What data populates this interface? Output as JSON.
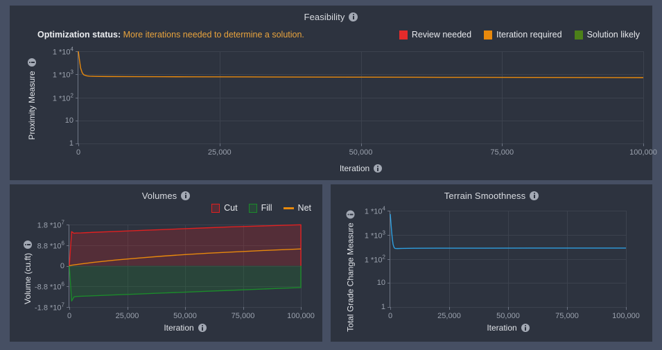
{
  "theme": {
    "page_background": "#464f63",
    "panel_background": "#2d333f",
    "grid_color": "#3c424e",
    "axis_text_color": "#9ba2ae",
    "title_color": "#d8dbe0"
  },
  "feasibility": {
    "title": "Feasibility",
    "info_icon": "info-icon",
    "status": {
      "label": "Optimization status:",
      "value": "More iterations needed to determine a solution.",
      "value_color": "#e8a33d"
    },
    "legend": [
      {
        "label": "Review needed",
        "color": "#e42b2b",
        "style": "box"
      },
      {
        "label": "Iteration required",
        "color": "#e8890c",
        "style": "box"
      },
      {
        "label": "Solution likely",
        "color": "#4c8019",
        "style": "box"
      }
    ]
  },
  "volumes": {
    "title": "Volumes",
    "info_icon": "info-icon",
    "legend": [
      {
        "label": "Cut",
        "color": "#e02020",
        "style": "hollow-box"
      },
      {
        "label": "Fill",
        "color": "#1c8a2b",
        "style": "hollow-box"
      },
      {
        "label": "Net",
        "color": "#e8890c",
        "style": "line"
      }
    ]
  },
  "terrain": {
    "title": "Terrain Smoothness",
    "info_icon": "info-icon"
  },
  "chart_data": [
    {
      "id": "feasibility",
      "type": "line",
      "title": "Feasibility",
      "xlabel": "Iteration",
      "ylabel": "Proximity Measure",
      "yscale": "log",
      "ylim": [
        1,
        10000
      ],
      "yticks": [
        1,
        10,
        100,
        1000,
        10000
      ],
      "ytick_labels": [
        "1",
        "10",
        "1 *10²",
        "1 *10³",
        "1 *10⁴"
      ],
      "xlim": [
        0,
        100000
      ],
      "xticks": [
        0,
        25000,
        50000,
        75000,
        100000
      ],
      "xtick_labels": [
        "0",
        "25,000",
        "50,000",
        "75,000",
        "100,000"
      ],
      "grid": true,
      "legend_position": "top-right",
      "series": [
        {
          "name": "Proximity Measure",
          "color": "#e8890c",
          "x": [
            0,
            200,
            400,
            700,
            1000,
            1500,
            2000,
            3000,
            5000,
            10000,
            15000,
            20000,
            30000,
            40000,
            50000,
            60000,
            70000,
            80000,
            90000,
            100000
          ],
          "y": [
            10000,
            4200,
            1900,
            1150,
            940,
            860,
            830,
            815,
            805,
            795,
            788,
            782,
            772,
            763,
            755,
            747,
            740,
            733,
            727,
            720
          ]
        }
      ]
    },
    {
      "id": "volumes",
      "type": "area",
      "title": "Volumes",
      "xlabel": "Iteration",
      "ylabel": "Volume (cu.ft)",
      "yscale": "linear",
      "ylim": [
        -18000000,
        18000000
      ],
      "yticks": [
        -18000000,
        -8800000,
        0,
        8800000,
        18000000
      ],
      "ytick_labels": [
        "-1.8 *10⁷",
        "-8.8 *10⁶",
        "0",
        "8.8 *10⁶",
        "1.8 *10⁷"
      ],
      "xlim": [
        0,
        100000
      ],
      "xticks": [
        0,
        25000,
        50000,
        75000,
        100000
      ],
      "xtick_labels": [
        "0",
        "25,000",
        "50,000",
        "75,000",
        "100,000"
      ],
      "grid": true,
      "legend_position": "top-right",
      "series": [
        {
          "name": "Cut",
          "color": "#e02020",
          "fill": "rgba(224,32,32,0.22)",
          "x": [
            0,
            1000,
            2000,
            3000,
            5000,
            10000,
            20000,
            30000,
            40000,
            50000,
            60000,
            70000,
            80000,
            90000,
            100000
          ],
          "y": [
            0,
            14900000,
            14200000,
            14300000,
            14350000,
            14600000,
            15000000,
            15400000,
            15800000,
            16200000,
            16600000,
            17000000,
            17300000,
            17600000,
            17900000
          ]
        },
        {
          "name": "Fill",
          "color": "#1c8a2b",
          "fill": "rgba(28,138,43,0.22)",
          "x": [
            0,
            1000,
            2000,
            3000,
            5000,
            10000,
            20000,
            30000,
            40000,
            50000,
            60000,
            70000,
            80000,
            90000,
            100000
          ],
          "y": [
            0,
            -15400000,
            -13600000,
            -13400000,
            -13300000,
            -13100000,
            -12700000,
            -12300000,
            -11900000,
            -11500000,
            -11100000,
            -10700000,
            -10300000,
            -9900000,
            -9500000
          ]
        },
        {
          "name": "Net",
          "color": "#e8890c",
          "x": [
            0,
            1000,
            5000,
            10000,
            20000,
            30000,
            40000,
            50000,
            60000,
            70000,
            80000,
            90000,
            100000
          ],
          "y": [
            0,
            250000,
            800000,
            1450000,
            2500000,
            3400000,
            4200000,
            4900000,
            5500000,
            6000000,
            6500000,
            6950000,
            7350000
          ]
        }
      ]
    },
    {
      "id": "terrain",
      "type": "line",
      "title": "Terrain Smoothness",
      "xlabel": "Iteration",
      "ylabel": "Total Grade Change Measure",
      "yscale": "log",
      "ylim": [
        1,
        10000
      ],
      "yticks": [
        1,
        10,
        100,
        1000,
        10000
      ],
      "ytick_labels": [
        "1",
        "10",
        "1 *10²",
        "1 *10³",
        "1 *10⁴"
      ],
      "xlim": [
        0,
        100000
      ],
      "xticks": [
        0,
        25000,
        50000,
        75000,
        100000
      ],
      "xtick_labels": [
        "0",
        "25,000",
        "50,000",
        "75,000",
        "100,000"
      ],
      "grid": true,
      "series": [
        {
          "name": "Total Grade Change Measure",
          "color": "#2e9fe0",
          "x": [
            0,
            300,
            600,
            900,
            1200,
            1600,
            2000,
            3000,
            5000,
            10000,
            20000,
            40000,
            60000,
            80000,
            100000
          ],
          "y": [
            7200,
            3000,
            1250,
            650,
            400,
            300,
            272,
            268,
            272,
            276,
            278,
            279,
            280,
            280,
            281
          ]
        }
      ]
    }
  ]
}
